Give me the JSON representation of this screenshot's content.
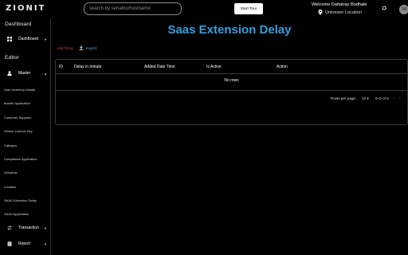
{
  "header": {
    "logo": "ZIONIT",
    "search_placeholder": "search by serialno/hostname",
    "start_tour": "Start Tour",
    "welcome": "Welcome Dattatray Bodhale",
    "location": "Unknown Location",
    "avatar_initials": "DB",
    "icons": {
      "pin": "location-pin-icon",
      "gear": "gear-icon"
    }
  },
  "sidebar": {
    "dashboard_section": "Dashboard",
    "dashboard_item": "DashBoard",
    "editor_section": "Editor",
    "master_item": "Master",
    "master_children": [
      "User Inventory Details",
      "Bundle Application",
      "Customer Supplied",
      "Worker Licence Key",
      "Category",
      "Compliance Application",
      "Schedule",
      "Location",
      "SAAS Extension Delay",
      "SAAS Application"
    ],
    "transaction_item": "Transaction",
    "report_item": "Report"
  },
  "main": {
    "title": "Saas Extension Delay",
    "add_label": "Add Delay",
    "export_label": "Export",
    "columns": [
      "ID",
      "Delay in minute",
      "Added Date Time",
      "Is Active",
      "Action"
    ],
    "empty_text": "No rows",
    "rows_per_page_label": "Rows per page:",
    "rows_per_page_value": "10",
    "range_text": "0–0 of 0"
  },
  "colors": {
    "title": "#2fa0e0",
    "add": "#d32f2f",
    "export": "#4aa3df",
    "background": "#000000"
  }
}
